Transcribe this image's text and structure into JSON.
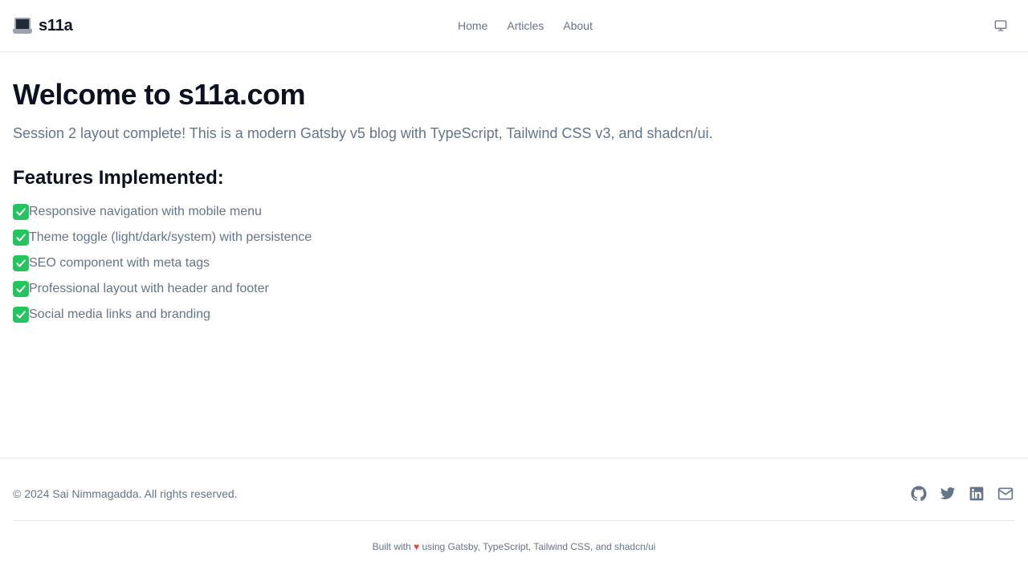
{
  "header": {
    "brand": "s11a",
    "nav": [
      {
        "label": "Home"
      },
      {
        "label": "Articles"
      },
      {
        "label": "About"
      }
    ],
    "theme_toggle_icon": "monitor-icon"
  },
  "main": {
    "title": "Welcome to s11a.com",
    "lead": "Session 2 layout complete! This is a modern Gatsby v5 blog with TypeScript, Tailwind CSS v3, and shadcn/ui.",
    "features_title": "Features Implemented:",
    "features": [
      {
        "text": "Responsive navigation with mobile menu"
      },
      {
        "text": "Theme toggle (light/dark/system) with persistence"
      },
      {
        "text": "SEO component with meta tags"
      },
      {
        "text": "Professional layout with header and footer"
      },
      {
        "text": "Social media links and branding"
      }
    ]
  },
  "footer": {
    "copyright": "© 2024 Sai Nimmagadda. All rights reserved.",
    "socials": [
      "github-icon",
      "twitter-icon",
      "linkedin-icon",
      "mail-icon"
    ],
    "built_prefix": "Built with",
    "built_suffix": "using Gatsby, TypeScript, Tailwind CSS, and shadcn/ui"
  },
  "colors": {
    "muted_text": "#64748b",
    "heading": "#0b1120",
    "check": "#22c55e",
    "heart": "#ef4444",
    "border": "#e5e7eb"
  }
}
